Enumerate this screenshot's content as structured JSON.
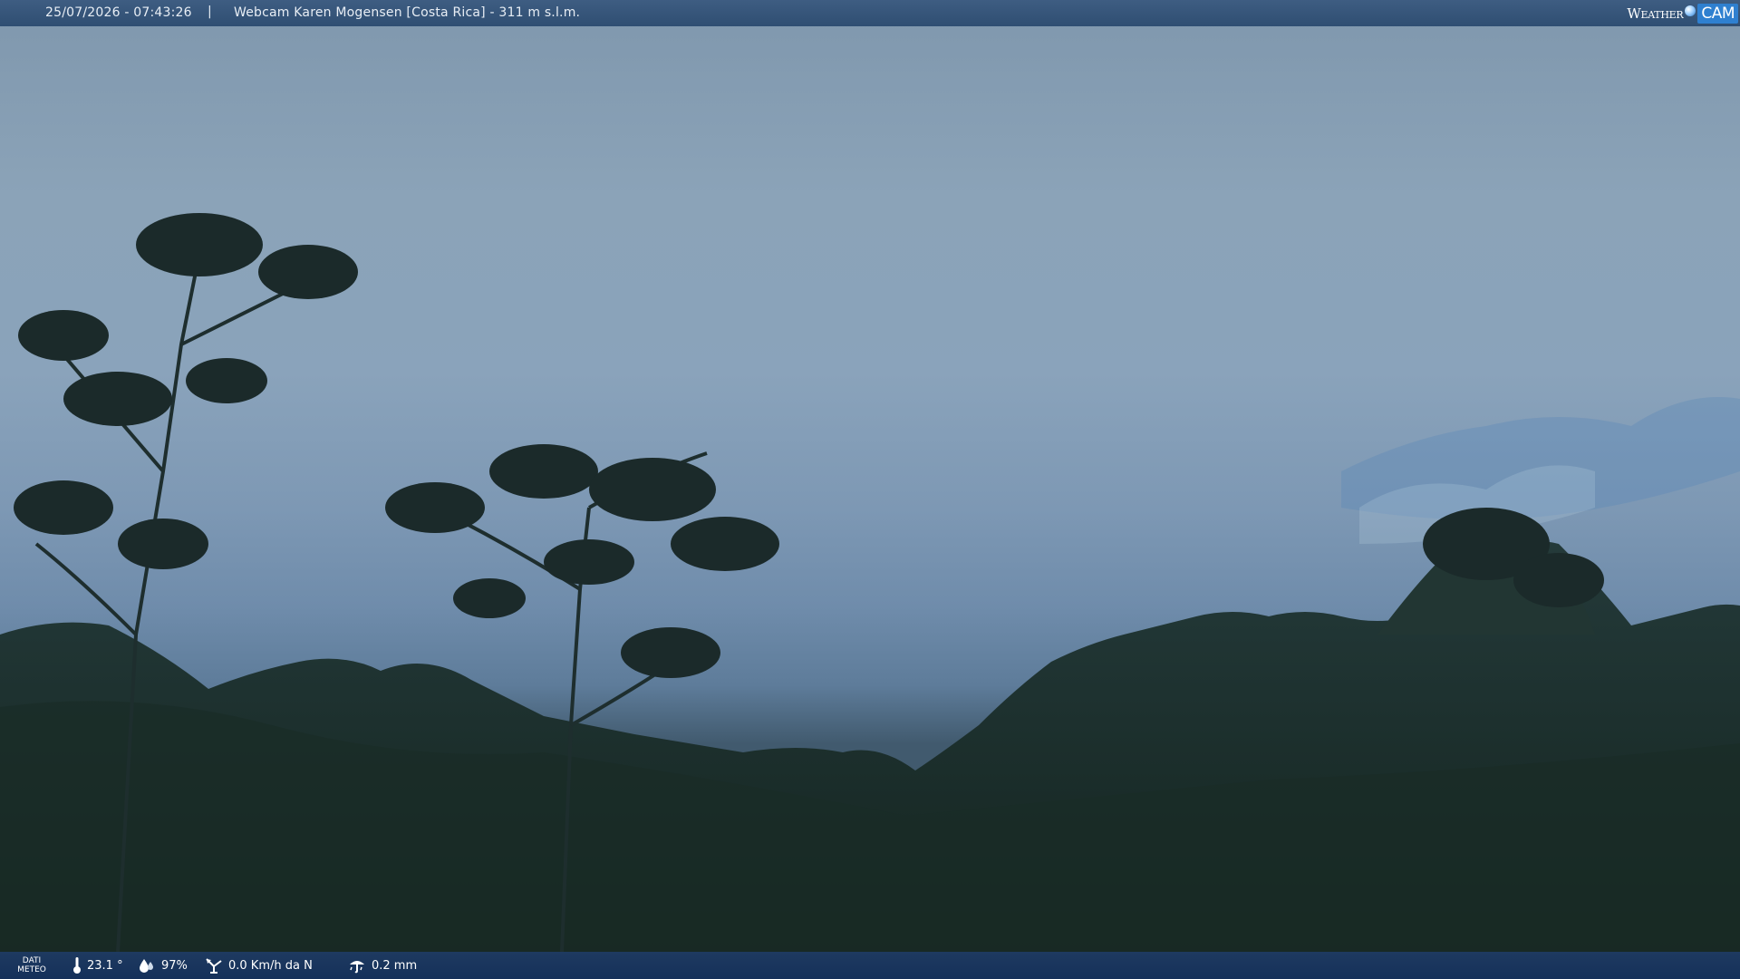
{
  "header": {
    "datetime": "25/07/2026 - 07:43:26",
    "separator": "|",
    "title": "Webcam Karen Mogensen [Costa Rica] - 311 m s.l.m.",
    "brand_left": "Weather",
    "brand_right": "CAM"
  },
  "weather": {
    "label_line1": "DATI",
    "label_line2": "METEO",
    "temperature": "23.1 °",
    "humidity": "97%",
    "wind": "0.0 Km/h da N",
    "rain": "0.2 mm",
    "icons": [
      "thermometer-icon",
      "humidity-drops-icon",
      "wind-vane-icon",
      "rain-gauge-icon"
    ]
  },
  "colors": {
    "header_bg": "#3e5d82",
    "footer_bg": "#1e3a60",
    "brand_accent": "#2f80d0"
  }
}
